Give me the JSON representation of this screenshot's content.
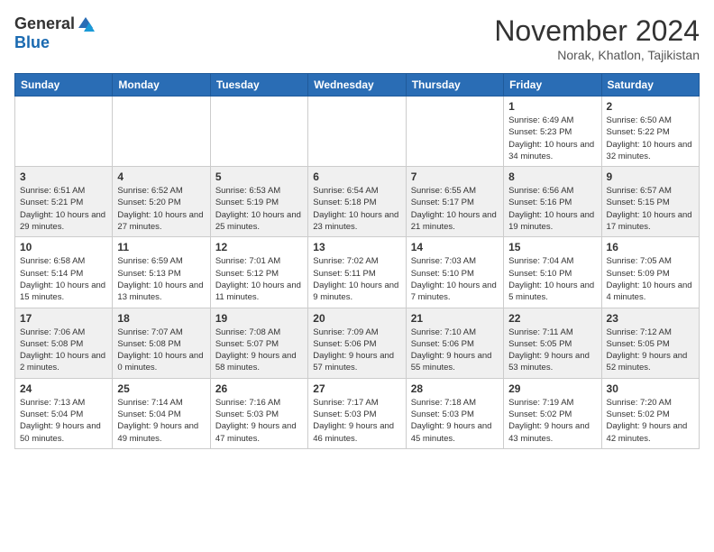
{
  "header": {
    "logo_general": "General",
    "logo_blue": "Blue",
    "month_title": "November 2024",
    "location": "Norak, Khatlon, Tajikistan"
  },
  "days_of_week": [
    "Sunday",
    "Monday",
    "Tuesday",
    "Wednesday",
    "Thursday",
    "Friday",
    "Saturday"
  ],
  "weeks": [
    [
      {
        "day": "",
        "info": ""
      },
      {
        "day": "",
        "info": ""
      },
      {
        "day": "",
        "info": ""
      },
      {
        "day": "",
        "info": ""
      },
      {
        "day": "",
        "info": ""
      },
      {
        "day": "1",
        "info": "Sunrise: 6:49 AM\nSunset: 5:23 PM\nDaylight: 10 hours and 34 minutes."
      },
      {
        "day": "2",
        "info": "Sunrise: 6:50 AM\nSunset: 5:22 PM\nDaylight: 10 hours and 32 minutes."
      }
    ],
    [
      {
        "day": "3",
        "info": "Sunrise: 6:51 AM\nSunset: 5:21 PM\nDaylight: 10 hours and 29 minutes."
      },
      {
        "day": "4",
        "info": "Sunrise: 6:52 AM\nSunset: 5:20 PM\nDaylight: 10 hours and 27 minutes."
      },
      {
        "day": "5",
        "info": "Sunrise: 6:53 AM\nSunset: 5:19 PM\nDaylight: 10 hours and 25 minutes."
      },
      {
        "day": "6",
        "info": "Sunrise: 6:54 AM\nSunset: 5:18 PM\nDaylight: 10 hours and 23 minutes."
      },
      {
        "day": "7",
        "info": "Sunrise: 6:55 AM\nSunset: 5:17 PM\nDaylight: 10 hours and 21 minutes."
      },
      {
        "day": "8",
        "info": "Sunrise: 6:56 AM\nSunset: 5:16 PM\nDaylight: 10 hours and 19 minutes."
      },
      {
        "day": "9",
        "info": "Sunrise: 6:57 AM\nSunset: 5:15 PM\nDaylight: 10 hours and 17 minutes."
      }
    ],
    [
      {
        "day": "10",
        "info": "Sunrise: 6:58 AM\nSunset: 5:14 PM\nDaylight: 10 hours and 15 minutes."
      },
      {
        "day": "11",
        "info": "Sunrise: 6:59 AM\nSunset: 5:13 PM\nDaylight: 10 hours and 13 minutes."
      },
      {
        "day": "12",
        "info": "Sunrise: 7:01 AM\nSunset: 5:12 PM\nDaylight: 10 hours and 11 minutes."
      },
      {
        "day": "13",
        "info": "Sunrise: 7:02 AM\nSunset: 5:11 PM\nDaylight: 10 hours and 9 minutes."
      },
      {
        "day": "14",
        "info": "Sunrise: 7:03 AM\nSunset: 5:10 PM\nDaylight: 10 hours and 7 minutes."
      },
      {
        "day": "15",
        "info": "Sunrise: 7:04 AM\nSunset: 5:10 PM\nDaylight: 10 hours and 5 minutes."
      },
      {
        "day": "16",
        "info": "Sunrise: 7:05 AM\nSunset: 5:09 PM\nDaylight: 10 hours and 4 minutes."
      }
    ],
    [
      {
        "day": "17",
        "info": "Sunrise: 7:06 AM\nSunset: 5:08 PM\nDaylight: 10 hours and 2 minutes."
      },
      {
        "day": "18",
        "info": "Sunrise: 7:07 AM\nSunset: 5:08 PM\nDaylight: 10 hours and 0 minutes."
      },
      {
        "day": "19",
        "info": "Sunrise: 7:08 AM\nSunset: 5:07 PM\nDaylight: 9 hours and 58 minutes."
      },
      {
        "day": "20",
        "info": "Sunrise: 7:09 AM\nSunset: 5:06 PM\nDaylight: 9 hours and 57 minutes."
      },
      {
        "day": "21",
        "info": "Sunrise: 7:10 AM\nSunset: 5:06 PM\nDaylight: 9 hours and 55 minutes."
      },
      {
        "day": "22",
        "info": "Sunrise: 7:11 AM\nSunset: 5:05 PM\nDaylight: 9 hours and 53 minutes."
      },
      {
        "day": "23",
        "info": "Sunrise: 7:12 AM\nSunset: 5:05 PM\nDaylight: 9 hours and 52 minutes."
      }
    ],
    [
      {
        "day": "24",
        "info": "Sunrise: 7:13 AM\nSunset: 5:04 PM\nDaylight: 9 hours and 50 minutes."
      },
      {
        "day": "25",
        "info": "Sunrise: 7:14 AM\nSunset: 5:04 PM\nDaylight: 9 hours and 49 minutes."
      },
      {
        "day": "26",
        "info": "Sunrise: 7:16 AM\nSunset: 5:03 PM\nDaylight: 9 hours and 47 minutes."
      },
      {
        "day": "27",
        "info": "Sunrise: 7:17 AM\nSunset: 5:03 PM\nDaylight: 9 hours and 46 minutes."
      },
      {
        "day": "28",
        "info": "Sunrise: 7:18 AM\nSunset: 5:03 PM\nDaylight: 9 hours and 45 minutes."
      },
      {
        "day": "29",
        "info": "Sunrise: 7:19 AM\nSunset: 5:02 PM\nDaylight: 9 hours and 43 minutes."
      },
      {
        "day": "30",
        "info": "Sunrise: 7:20 AM\nSunset: 5:02 PM\nDaylight: 9 hours and 42 minutes."
      }
    ]
  ]
}
